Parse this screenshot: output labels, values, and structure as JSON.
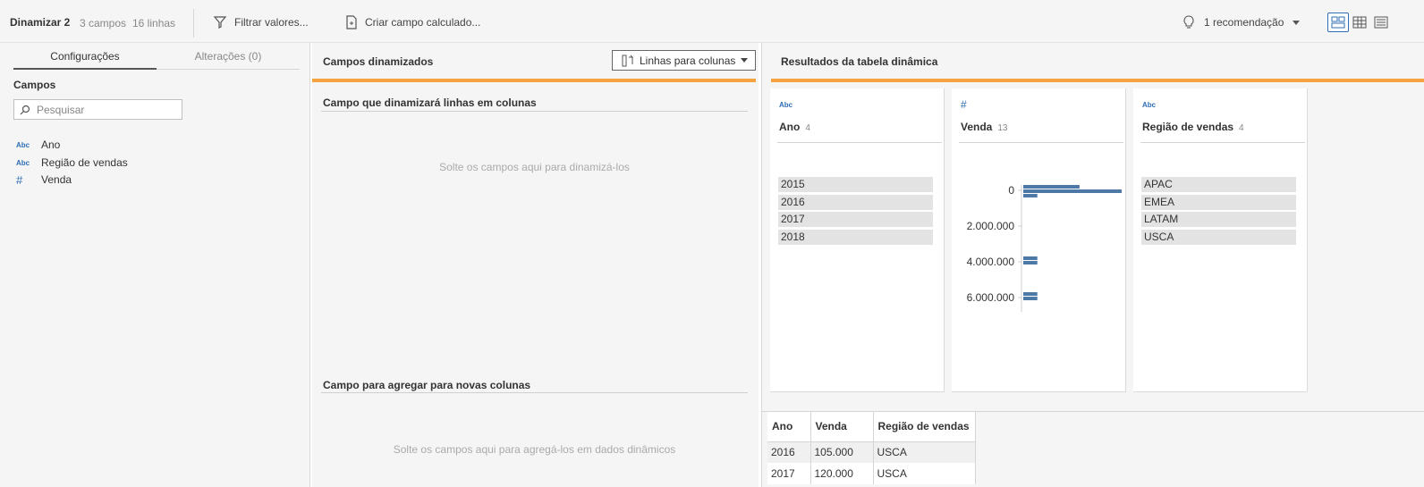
{
  "toolbar": {
    "title": "Dinamizar 2",
    "fields_count": "3 campos",
    "rows_count": "16 linhas",
    "filter_label": "Filtrar valores...",
    "calc_label": "Criar campo calculado...",
    "recommendation": "1 recomendação"
  },
  "left": {
    "tabs": [
      "Configurações",
      "Alterações (0)"
    ],
    "fields_heading": "Campos",
    "search_placeholder": "Pesquisar",
    "fields": [
      {
        "type": "Abc",
        "name": "Ano"
      },
      {
        "type": "Abc",
        "name": "Região de vendas"
      },
      {
        "type": "#",
        "name": "Venda"
      }
    ]
  },
  "middle": {
    "title": "Campos dinamizados",
    "mode_button": "Linhas para colunas",
    "zone1_title": "Campo que dinamizará linhas em colunas",
    "zone1_hint": "Solte os campos aqui para dinamizá-los",
    "zone2_title": "Campo para agregar para novas colunas",
    "zone2_hint": "Solte os campos aqui para agregá-los em dados dinâmicos"
  },
  "right": {
    "title": "Resultados da tabela dinâmica",
    "cards": [
      {
        "type": "Abc",
        "name": "Ano",
        "count": "4",
        "values": [
          "2015",
          "2016",
          "2017",
          "2018"
        ]
      },
      {
        "type": "#",
        "name": "Venda",
        "count": "13",
        "axis_labels": [
          "0",
          "2.000.000",
          "4.000.000",
          "6.000.000"
        ]
      },
      {
        "type": "Abc",
        "name": "Região de vendas",
        "count": "4",
        "values": [
          "APAC",
          "EMEA",
          "LATAM",
          "USCA"
        ]
      }
    ],
    "table": {
      "headers": [
        "Ano",
        "Venda",
        "Região de vendas"
      ],
      "rows": [
        [
          "2016",
          "105.000",
          "USCA"
        ],
        [
          "2017",
          "120.000",
          "USCA"
        ]
      ]
    }
  },
  "colors": {
    "accent_orange": "#f4a340",
    "bar_blue": "#4e79a7",
    "type_blue": "#2e6eb5"
  },
  "chart_data": {
    "type": "bar",
    "orientation": "horizontal-histogram",
    "ylabel": "",
    "xlabel": "",
    "bins": [
      {
        "bin_start": 0,
        "count": 4
      },
      {
        "bin_start": 250000,
        "count": 7
      },
      {
        "bin_start": 500000,
        "count": 1
      },
      {
        "bin_start": 4000000,
        "count": 1
      },
      {
        "bin_start": 4250000,
        "count": 1
      },
      {
        "bin_start": 6000000,
        "count": 1
      },
      {
        "bin_start": 6250000,
        "count": 1
      }
    ],
    "ylim": [
      0,
      6500000
    ],
    "ticks": [
      0,
      2000000,
      4000000,
      6000000
    ]
  }
}
